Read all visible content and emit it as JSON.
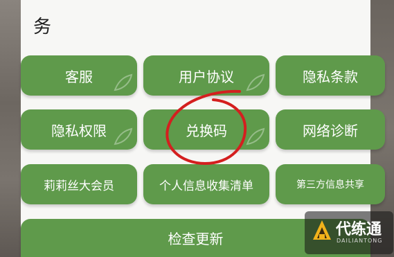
{
  "section": {
    "title": "务"
  },
  "buttons": [
    {
      "label": "客服"
    },
    {
      "label": "用户协议"
    },
    {
      "label": "隐私条款"
    },
    {
      "label": "隐私权限"
    },
    {
      "label": "兑换码"
    },
    {
      "label": "网络诊断"
    },
    {
      "label": "莉莉丝大会员"
    },
    {
      "label": "个人信息收集清单"
    },
    {
      "label": "第三方信息共享"
    },
    {
      "label": "检查更新"
    }
  ],
  "watermark": {
    "text": "代练通",
    "sub": "DAILIANTONG"
  },
  "colors": {
    "button_green": "#5f9a4b",
    "circle_red": "#d41f1f",
    "panel": "#f7f7f5"
  }
}
